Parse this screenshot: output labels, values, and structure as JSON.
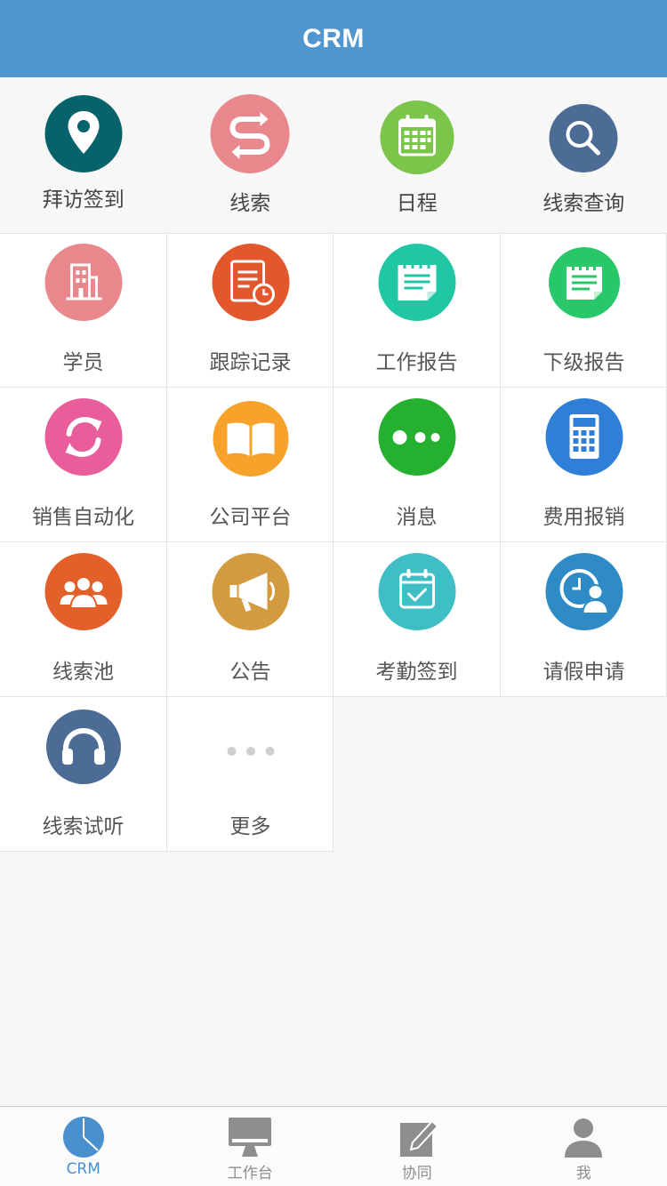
{
  "header": {
    "title": "CRM"
  },
  "colors": {
    "header_bg": "#5196cf",
    "tab_active": "#4a8fce",
    "tab_inactive": "#8e8e8e"
  },
  "quick_actions": [
    {
      "label": "拜访签到",
      "icon": "location-pin-icon",
      "color": "#07636b"
    },
    {
      "label": "线索",
      "icon": "route-arrows-icon",
      "color": "#e8878c"
    },
    {
      "label": "日程",
      "icon": "calendar-icon",
      "color": "#7bc54b"
    },
    {
      "label": "线索查询",
      "icon": "search-icon",
      "color": "#4d6c95"
    }
  ],
  "grid": [
    {
      "label": "学员",
      "icon": "building-icon",
      "color": "#e8878c"
    },
    {
      "label": "跟踪记录",
      "icon": "document-clock-icon",
      "color": "#e2572c"
    },
    {
      "label": "工作报告",
      "icon": "notepad-icon",
      "color": "#21c7a4"
    },
    {
      "label": "下级报告",
      "icon": "notepad-icon",
      "color": "#27c76a"
    },
    {
      "label": "销售自动化",
      "icon": "refresh-arrows-icon",
      "color": "#e95d9a"
    },
    {
      "label": "公司平台",
      "icon": "open-book-icon",
      "color": "#f7a32b"
    },
    {
      "label": "消息",
      "icon": "chat-dots-icon",
      "color": "#25b12f"
    },
    {
      "label": "费用报销",
      "icon": "calculator-icon",
      "color": "#2f7fd9"
    },
    {
      "label": "线索池",
      "icon": "group-icon",
      "color": "#e4602b"
    },
    {
      "label": "公告",
      "icon": "megaphone-icon",
      "color": "#d39b3f"
    },
    {
      "label": "考勤签到",
      "icon": "calendar-check-icon",
      "color": "#3fbec6"
    },
    {
      "label": "请假申请",
      "icon": "clock-person-icon",
      "color": "#2e8bc6"
    },
    {
      "label": "线索试听",
      "icon": "headphones-icon",
      "color": "#4d6c95"
    },
    {
      "label": "更多",
      "icon": "more-dots-icon",
      "color": "#cfcfcf"
    }
  ],
  "tabs": [
    {
      "label": "CRM",
      "icon": "pie-chart-icon",
      "active": true
    },
    {
      "label": "工作台",
      "icon": "monitor-icon",
      "active": false
    },
    {
      "label": "协同",
      "icon": "edit-pencil-icon",
      "active": false
    },
    {
      "label": "我",
      "icon": "person-icon",
      "active": false
    }
  ]
}
